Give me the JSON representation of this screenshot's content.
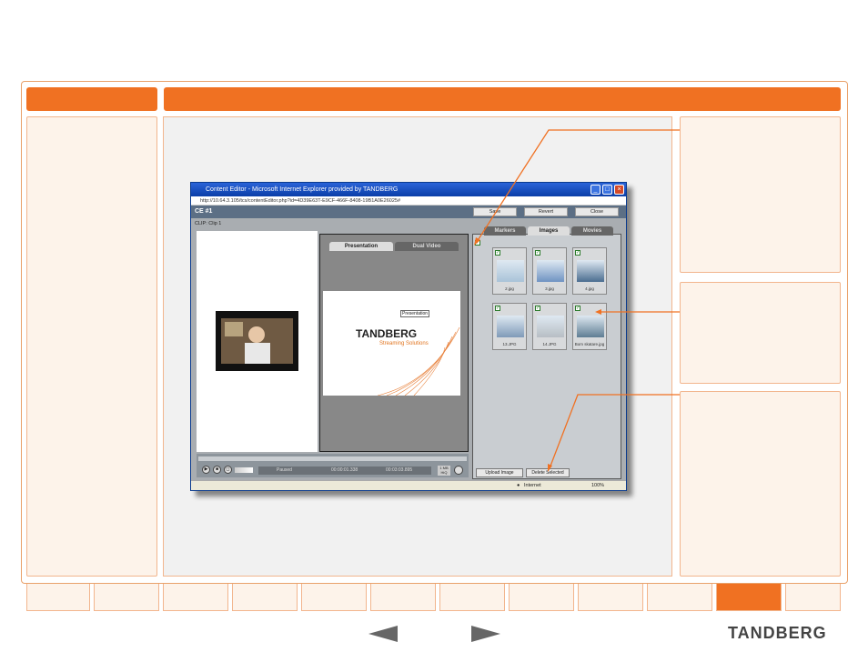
{
  "window": {
    "title": "Content Editor - Microsoft Internet Explorer provided by TANDBERG",
    "url": "http://10.64.3.105/tcs/contentEditor.php?id=4D39E63T-E9CF-466F-8408-19B1A0E26025#",
    "status_zone": "Internet",
    "zoom": "100%"
  },
  "editor": {
    "title": "CE #1",
    "save": "Save",
    "revert": "Revert",
    "close": "Close",
    "clip_label": "CLIP: Clip 1"
  },
  "tabs_left": [
    "Presentation",
    "Dual Video"
  ],
  "tabs_right": [
    "Markers",
    "Images",
    "Movies"
  ],
  "slide": {
    "badge": "Presentation",
    "brand": "TANDBERG",
    "tagline": "Streaming Solutions"
  },
  "player": {
    "state": "Paused",
    "time_current": "00:00:01.338",
    "time_total": "00:03:03.895",
    "bitrate": "1 MB",
    "quality": "HiQ"
  },
  "images": [
    {
      "name": "2.jpg",
      "color": "#a9c3d8"
    },
    {
      "name": "3.jpg",
      "color": "#6f93c2"
    },
    {
      "name": "4.jpg",
      "color": "#4a6d90"
    },
    {
      "name": "13.JPG",
      "color": "#7f9ab8"
    },
    {
      "name": "14.JPG",
      "color": "#b7bec4"
    },
    {
      "name": "Bom skatare.jpg",
      "color": "#5e7d93"
    }
  ],
  "buttons": {
    "upload": "Upload Image",
    "delete": "Delete Selected"
  },
  "logo": "TANDBERG",
  "colors": {
    "accent": "#f07122"
  }
}
